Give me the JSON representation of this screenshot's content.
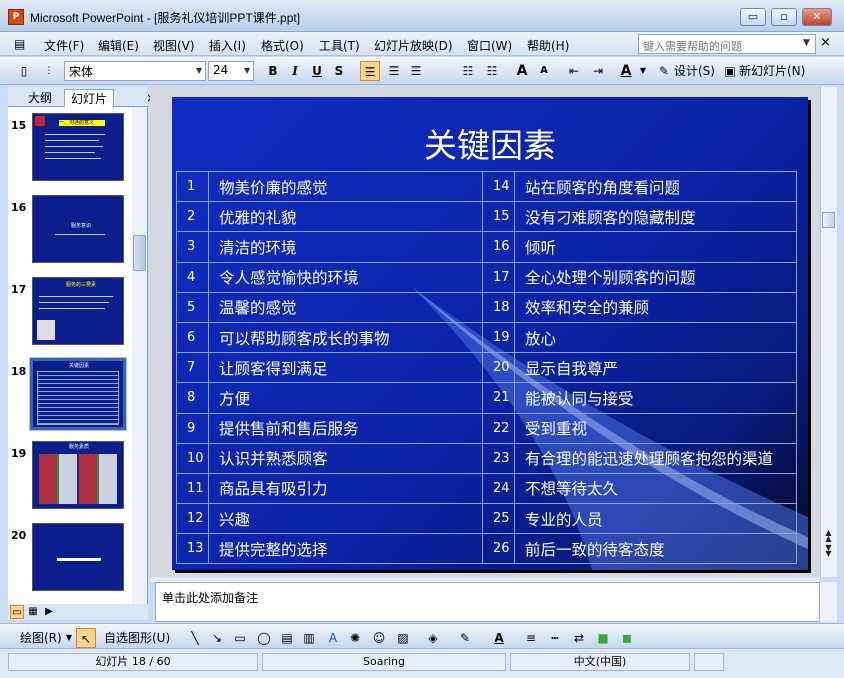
{
  "window": {
    "title": "Microsoft PowerPoint - [服务礼仪培训PPT课件.ppt]",
    "app_icon": "P",
    "minimize": "▭",
    "restore": "▫",
    "close": "✕"
  },
  "menu": {
    "file": "文件(F)",
    "edit": "编辑(E)",
    "view": "视图(V)",
    "insert": "插入(I)",
    "format": "格式(O)",
    "tools": "工具(T)",
    "slideshow": "幻灯片放映(D)",
    "window": "窗口(W)",
    "help": "帮助(H)",
    "help_placeholder": "键入需要帮助的问题",
    "close": "×"
  },
  "toolbar": {
    "font": "宋体",
    "size": "24",
    "bold": "B",
    "italic": "I",
    "underline": "U",
    "shadow": "S",
    "design": "设计(S)",
    "new_slide": "新幻灯片(N)",
    "grow_font": "A",
    "shrink_font": "A",
    "font_color": "A"
  },
  "panel": {
    "tab_outline": "大纲",
    "tab_slides": "幻灯片",
    "close": "×"
  },
  "thumbnails": [
    {
      "number": "15",
      "text": "一、沟通的意义"
    },
    {
      "number": "16",
      "text": "服务意识"
    },
    {
      "number": "17",
      "text": "服务的三要素"
    },
    {
      "number": "18",
      "text": "关键因素"
    },
    {
      "number": "19",
      "text": "服务素质"
    },
    {
      "number": "20",
      "text": ""
    }
  ],
  "slide": {
    "title": "关键因素",
    "rows": [
      {
        "n1": "1",
        "t1": "物美价廉的感觉",
        "n2": "14",
        "t2": "站在顾客的角度看问题"
      },
      {
        "n1": "2",
        "t1": "优雅的礼貌",
        "n2": "15",
        "t2": "没有刁难顾客的隐藏制度"
      },
      {
        "n1": "3",
        "t1": "清洁的环境",
        "n2": "16",
        "t2": "倾听"
      },
      {
        "n1": "4",
        "t1": "令人感觉愉快的环境",
        "n2": "17",
        "t2": "全心处理个别顾客的问题"
      },
      {
        "n1": "5",
        "t1": "温馨的感觉",
        "n2": "18",
        "t2": "效率和安全的兼顾"
      },
      {
        "n1": "6",
        "t1": "可以帮助顾客成长的事物",
        "n2": "19",
        "t2": "放心"
      },
      {
        "n1": "7",
        "t1": "让顾客得到满足",
        "n2": "20",
        "t2": "显示自我尊严"
      },
      {
        "n1": "8",
        "t1": "方便",
        "n2": "21",
        "t2": "能被认同与接受"
      },
      {
        "n1": "9",
        "t1": "提供售前和售后服务",
        "n2": "22",
        "t2": "受到重视"
      },
      {
        "n1": "10",
        "t1": "认识并熟悉顾客",
        "n2": "23",
        "t2": "有合理的能迅速处理顾客抱怨的渠道"
      },
      {
        "n1": "11",
        "t1": "商品具有吸引力",
        "n2": "24",
        "t2": "不想等待太久"
      },
      {
        "n1": "12",
        "t1": "兴趣",
        "n2": "25",
        "t2": "专业的人员"
      },
      {
        "n1": "13",
        "t1": "提供完整的选择",
        "n2": "26",
        "t2": "前后一致的待客态度"
      }
    ]
  },
  "notes": {
    "placeholder": "单击此处添加备注"
  },
  "drawbar": {
    "draw": "绘图(R)",
    "autoshape": "自选图形(U)"
  },
  "status": {
    "slide": "幻灯片 18 / 60",
    "design": "Soaring",
    "language": "中文(中国)"
  },
  "colors": {
    "slide_bg": "#0f2dc2",
    "accent": "#fbd38e"
  }
}
